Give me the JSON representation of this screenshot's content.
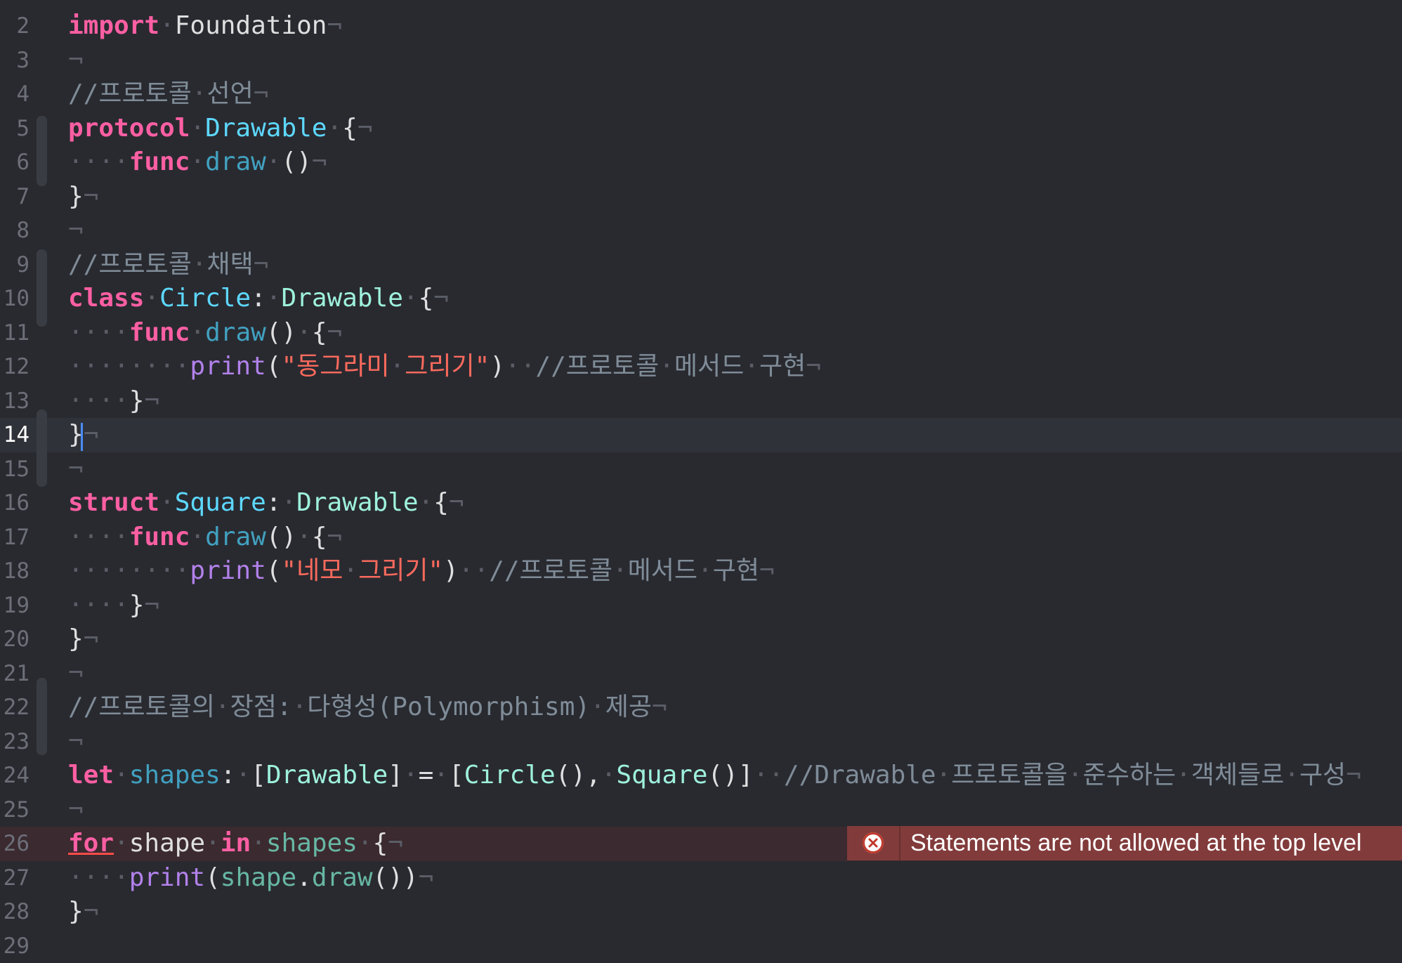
{
  "editor": {
    "lines": [
      {
        "number": "2",
        "tokens": [
          {
            "t": "import",
            "c": "keyword"
          },
          {
            "t": "·",
            "c": "inv"
          },
          {
            "t": "Foundation",
            "c": "plain"
          },
          {
            "t": "¬",
            "c": "inv"
          }
        ]
      },
      {
        "number": "3",
        "tokens": [
          {
            "t": "¬",
            "c": "inv"
          }
        ]
      },
      {
        "number": "4",
        "tokens": [
          {
            "t": "//프로토콜",
            "c": "comment"
          },
          {
            "t": "·",
            "c": "inv"
          },
          {
            "t": "선언",
            "c": "comment"
          },
          {
            "t": "¬",
            "c": "inv"
          }
        ]
      },
      {
        "number": "5",
        "tokens": [
          {
            "t": "protocol",
            "c": "keyword"
          },
          {
            "t": "·",
            "c": "inv"
          },
          {
            "t": "Drawable",
            "c": "type-decl"
          },
          {
            "t": "·",
            "c": "inv"
          },
          {
            "t": "{",
            "c": "plain"
          },
          {
            "t": "¬",
            "c": "inv"
          }
        ]
      },
      {
        "number": "6",
        "tokens": [
          {
            "t": "····",
            "c": "inv"
          },
          {
            "t": "func",
            "c": "keyword"
          },
          {
            "t": "·",
            "c": "inv"
          },
          {
            "t": "draw",
            "c": "func-decl"
          },
          {
            "t": "·",
            "c": "inv"
          },
          {
            "t": "()",
            "c": "plain"
          },
          {
            "t": "¬",
            "c": "inv"
          }
        ]
      },
      {
        "number": "7",
        "tokens": [
          {
            "t": "}",
            "c": "plain"
          },
          {
            "t": "¬",
            "c": "inv"
          }
        ]
      },
      {
        "number": "8",
        "tokens": [
          {
            "t": "¬",
            "c": "inv"
          }
        ]
      },
      {
        "number": "9",
        "tokens": [
          {
            "t": "//프로토콜",
            "c": "comment"
          },
          {
            "t": "·",
            "c": "inv"
          },
          {
            "t": "채택",
            "c": "comment"
          },
          {
            "t": "¬",
            "c": "inv"
          }
        ]
      },
      {
        "number": "10",
        "tokens": [
          {
            "t": "class",
            "c": "keyword"
          },
          {
            "t": "·",
            "c": "inv"
          },
          {
            "t": "Circle",
            "c": "type-decl"
          },
          {
            "t": ":",
            "c": "plain"
          },
          {
            "t": "·",
            "c": "inv"
          },
          {
            "t": "Drawable",
            "c": "type"
          },
          {
            "t": "·",
            "c": "inv"
          },
          {
            "t": "{",
            "c": "plain"
          },
          {
            "t": "¬",
            "c": "inv"
          }
        ]
      },
      {
        "number": "11",
        "tokens": [
          {
            "t": "····",
            "c": "inv"
          },
          {
            "t": "func",
            "c": "keyword"
          },
          {
            "t": "·",
            "c": "inv"
          },
          {
            "t": "draw",
            "c": "func-decl"
          },
          {
            "t": "()",
            "c": "plain"
          },
          {
            "t": "·",
            "c": "inv"
          },
          {
            "t": "{",
            "c": "plain"
          },
          {
            "t": "¬",
            "c": "inv"
          }
        ]
      },
      {
        "number": "12",
        "tokens": [
          {
            "t": "········",
            "c": "inv"
          },
          {
            "t": "print",
            "c": "builtin"
          },
          {
            "t": "(",
            "c": "plain"
          },
          {
            "t": "\"동그라미",
            "c": "string"
          },
          {
            "t": "·",
            "c": "inv"
          },
          {
            "t": "그리기\"",
            "c": "string"
          },
          {
            "t": ")",
            "c": "plain"
          },
          {
            "t": "··",
            "c": "inv"
          },
          {
            "t": "//프로토콜",
            "c": "comment"
          },
          {
            "t": "·",
            "c": "inv"
          },
          {
            "t": "메서드",
            "c": "comment"
          },
          {
            "t": "·",
            "c": "inv"
          },
          {
            "t": "구현",
            "c": "comment"
          },
          {
            "t": "¬",
            "c": "inv"
          }
        ]
      },
      {
        "number": "13",
        "tokens": [
          {
            "t": "····",
            "c": "inv"
          },
          {
            "t": "}",
            "c": "plain"
          },
          {
            "t": "¬",
            "c": "inv"
          }
        ]
      },
      {
        "number": "14",
        "current": true,
        "tokens": [
          {
            "t": "}",
            "c": "plain"
          },
          {
            "t": "¬",
            "c": "inv"
          }
        ]
      },
      {
        "number": "15",
        "tokens": [
          {
            "t": "¬",
            "c": "inv"
          }
        ]
      },
      {
        "number": "16",
        "tokens": [
          {
            "t": "struct",
            "c": "keyword"
          },
          {
            "t": "·",
            "c": "inv"
          },
          {
            "t": "Square",
            "c": "type-decl"
          },
          {
            "t": ":",
            "c": "plain"
          },
          {
            "t": "·",
            "c": "inv"
          },
          {
            "t": "Drawable",
            "c": "type"
          },
          {
            "t": "·",
            "c": "inv"
          },
          {
            "t": "{",
            "c": "plain"
          },
          {
            "t": "¬",
            "c": "inv"
          }
        ]
      },
      {
        "number": "17",
        "tokens": [
          {
            "t": "····",
            "c": "inv"
          },
          {
            "t": "func",
            "c": "keyword"
          },
          {
            "t": "·",
            "c": "inv"
          },
          {
            "t": "draw",
            "c": "func-decl"
          },
          {
            "t": "()",
            "c": "plain"
          },
          {
            "t": "·",
            "c": "inv"
          },
          {
            "t": "{",
            "c": "plain"
          },
          {
            "t": "¬",
            "c": "inv"
          }
        ]
      },
      {
        "number": "18",
        "tokens": [
          {
            "t": "········",
            "c": "inv"
          },
          {
            "t": "print",
            "c": "builtin"
          },
          {
            "t": "(",
            "c": "plain"
          },
          {
            "t": "\"네모",
            "c": "string"
          },
          {
            "t": "·",
            "c": "inv"
          },
          {
            "t": "그리기\"",
            "c": "string"
          },
          {
            "t": ")",
            "c": "plain"
          },
          {
            "t": "··",
            "c": "inv"
          },
          {
            "t": "//프로토콜",
            "c": "comment"
          },
          {
            "t": "·",
            "c": "inv"
          },
          {
            "t": "메서드",
            "c": "comment"
          },
          {
            "t": "·",
            "c": "inv"
          },
          {
            "t": "구현",
            "c": "comment"
          },
          {
            "t": "¬",
            "c": "inv"
          }
        ]
      },
      {
        "number": "19",
        "tokens": [
          {
            "t": "····",
            "c": "inv"
          },
          {
            "t": "}",
            "c": "plain"
          },
          {
            "t": "¬",
            "c": "inv"
          }
        ]
      },
      {
        "number": "20",
        "tokens": [
          {
            "t": "}",
            "c": "plain"
          },
          {
            "t": "¬",
            "c": "inv"
          }
        ]
      },
      {
        "number": "21",
        "tokens": [
          {
            "t": "¬",
            "c": "inv"
          }
        ]
      },
      {
        "number": "22",
        "tokens": [
          {
            "t": "//프로토콜의",
            "c": "comment"
          },
          {
            "t": "·",
            "c": "inv"
          },
          {
            "t": "장점:",
            "c": "comment"
          },
          {
            "t": "·",
            "c": "inv"
          },
          {
            "t": "다형성(Polymorphism)",
            "c": "comment"
          },
          {
            "t": "·",
            "c": "inv"
          },
          {
            "t": "제공",
            "c": "comment"
          },
          {
            "t": "¬",
            "c": "inv"
          }
        ]
      },
      {
        "number": "23",
        "tokens": [
          {
            "t": "¬",
            "c": "inv"
          }
        ]
      },
      {
        "number": "24",
        "tokens": [
          {
            "t": "let",
            "c": "keyword"
          },
          {
            "t": "·",
            "c": "inv"
          },
          {
            "t": "shapes",
            "c": "func-decl"
          },
          {
            "t": ":",
            "c": "plain"
          },
          {
            "t": "·",
            "c": "inv"
          },
          {
            "t": "[",
            "c": "plain"
          },
          {
            "t": "Drawable",
            "c": "type"
          },
          {
            "t": "]",
            "c": "plain"
          },
          {
            "t": "·",
            "c": "inv"
          },
          {
            "t": "=",
            "c": "plain"
          },
          {
            "t": "·",
            "c": "inv"
          },
          {
            "t": "[",
            "c": "plain"
          },
          {
            "t": "Circle",
            "c": "type"
          },
          {
            "t": "(),",
            "c": "plain"
          },
          {
            "t": "·",
            "c": "inv"
          },
          {
            "t": "Square",
            "c": "type"
          },
          {
            "t": "()]",
            "c": "plain"
          },
          {
            "t": "··",
            "c": "inv"
          },
          {
            "t": "//Drawable",
            "c": "comment"
          },
          {
            "t": "·",
            "c": "inv"
          },
          {
            "t": "프로토콜을",
            "c": "comment"
          },
          {
            "t": "·",
            "c": "inv"
          },
          {
            "t": "준수하는",
            "c": "comment"
          },
          {
            "t": "·",
            "c": "inv"
          },
          {
            "t": "객체들로",
            "c": "comment"
          },
          {
            "t": "·",
            "c": "inv"
          },
          {
            "t": "구성",
            "c": "comment"
          },
          {
            "t": "¬",
            "c": "inv"
          }
        ]
      },
      {
        "number": "25",
        "tokens": [
          {
            "t": "¬",
            "c": "inv"
          }
        ]
      },
      {
        "number": "26",
        "error": true,
        "tokens": [
          {
            "t": "for",
            "c": "keyword",
            "underline": true
          },
          {
            "t": "·",
            "c": "inv"
          },
          {
            "t": "shape",
            "c": "plain"
          },
          {
            "t": "·",
            "c": "inv"
          },
          {
            "t": "in",
            "c": "keyword"
          },
          {
            "t": "·",
            "c": "inv"
          },
          {
            "t": "shapes",
            "c": "func"
          },
          {
            "t": "·",
            "c": "inv"
          },
          {
            "t": "{",
            "c": "plain"
          },
          {
            "t": "¬",
            "c": "inv"
          }
        ]
      },
      {
        "number": "27",
        "tokens": [
          {
            "t": "····",
            "c": "inv"
          },
          {
            "t": "print",
            "c": "builtin"
          },
          {
            "t": "(",
            "c": "plain"
          },
          {
            "t": "shape",
            "c": "func"
          },
          {
            "t": ".",
            "c": "plain"
          },
          {
            "t": "draw",
            "c": "func"
          },
          {
            "t": "())",
            "c": "plain"
          },
          {
            "t": "¬",
            "c": "inv"
          }
        ]
      },
      {
        "number": "28",
        "tokens": [
          {
            "t": "}",
            "c": "plain"
          },
          {
            "t": "¬",
            "c": "inv"
          }
        ]
      },
      {
        "number": "29",
        "tokens": []
      }
    ],
    "error_message": "Statements are not allowed at the top level",
    "error_icon": "error-x-circle-icon",
    "colors": {
      "background": "#292a30",
      "current_line": "#2f3239",
      "error_line": "#3b2a2f",
      "error_banner": "#823b3b",
      "keyword": "#fc5fa3",
      "type_declaration": "#5dd8ff",
      "type": "#9ef1dd",
      "function": "#67b7a4",
      "builtin": "#b281eb",
      "string": "#fc6a5d",
      "comment": "#7f8c98",
      "caret": "#4a8cf8"
    }
  }
}
